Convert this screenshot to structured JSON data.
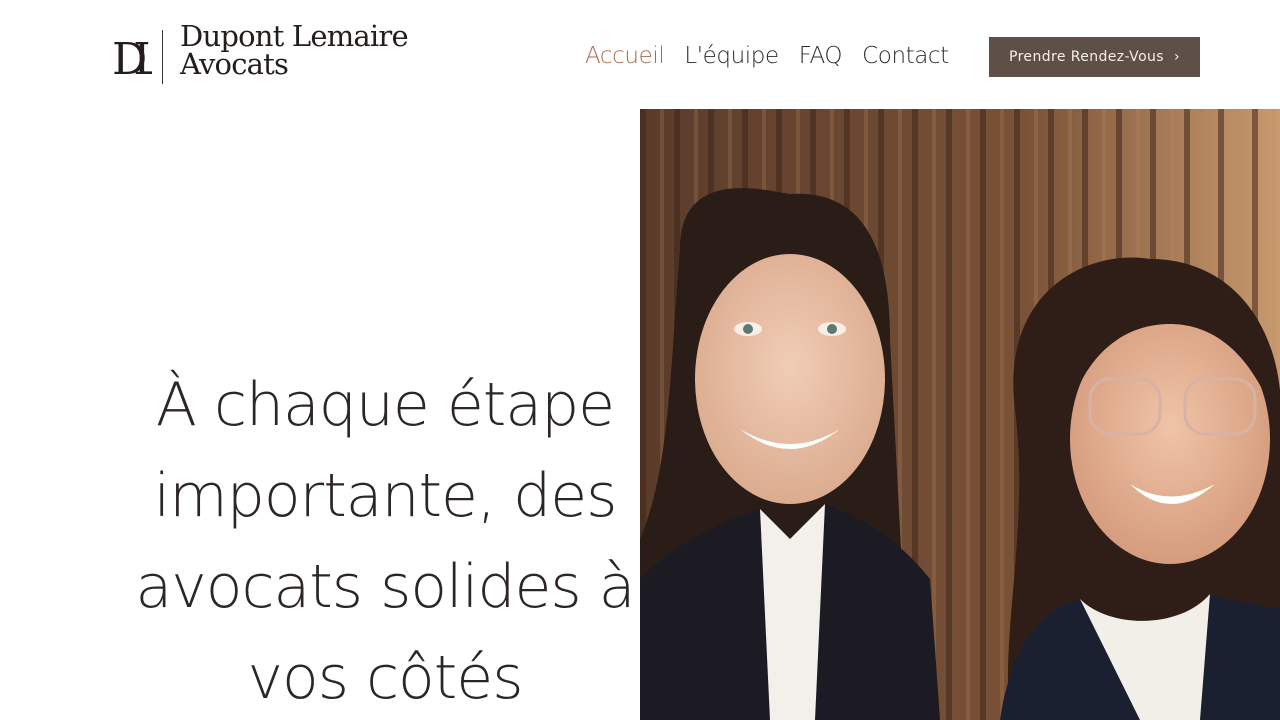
{
  "brand": {
    "monogram": "DL",
    "name_line1": "Dupont Lemaire",
    "name_line2": "Avocats"
  },
  "nav": {
    "items": [
      {
        "label": "Accueil",
        "active": true
      },
      {
        "label": "L'équipe",
        "active": false
      },
      {
        "label": "FAQ",
        "active": false
      },
      {
        "label": "Contact",
        "active": false
      }
    ]
  },
  "cta": {
    "label": "Prendre Rendez-Vous",
    "icon": "chevron-right-icon"
  },
  "hero": {
    "lines": [
      "À chaque étape",
      "importante, des",
      "avocats solides à",
      "vos côtés"
    ]
  },
  "colors": {
    "accent": "#a86a4a",
    "button_bg": "#5e5049",
    "text": "#2c2724"
  }
}
